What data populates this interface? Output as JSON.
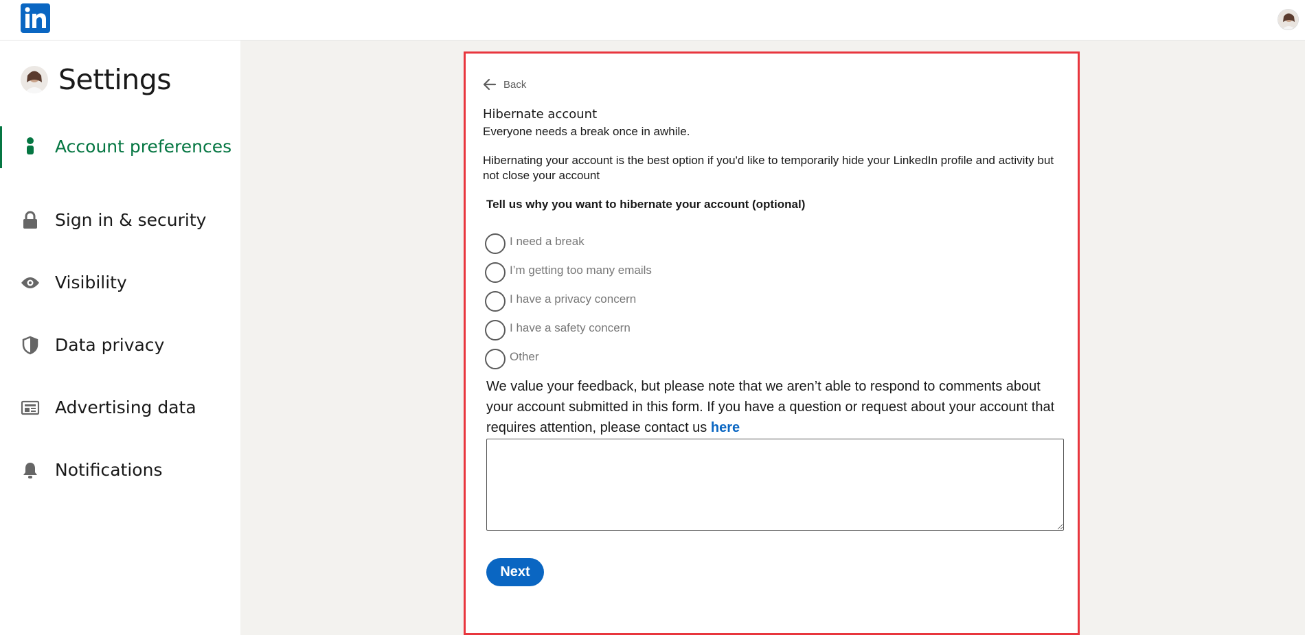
{
  "brand": {
    "logo_text": "in",
    "color": "#0a66c2"
  },
  "sidebar": {
    "title": "Settings",
    "items": [
      {
        "label": "Account preferences",
        "icon": "person-icon",
        "active": true
      },
      {
        "label": "Sign in & security",
        "icon": "lock-icon"
      },
      {
        "label": "Visibility",
        "icon": "eye-icon"
      },
      {
        "label": "Data privacy",
        "icon": "shield-icon"
      },
      {
        "label": "Advertising data",
        "icon": "newspaper-icon"
      },
      {
        "label": "Notifications",
        "icon": "bell-icon"
      }
    ]
  },
  "main": {
    "back_label": "Back",
    "title": "Hibernate account",
    "subtitle": "Everyone needs a break once in awhile.",
    "description": "Hibernating your account is the best option if you'd like to temporarily hide your LinkedIn profile and activity but not close your account",
    "question": "Tell us why you want to hibernate your account (optional)",
    "options": [
      "I need a break",
      "I’m getting too many emails",
      "I have a privacy concern",
      "I have a safety concern",
      "Other"
    ],
    "feedback_text": "We value your feedback, but please note that we aren’t able to respond to comments about your account submitted in this form. If you have a question or request about your account that requires attention, please contact us",
    "feedback_link": "here",
    "textarea_value": "",
    "next_label": "Next"
  },
  "colors": {
    "accent_green": "#057642",
    "highlight_border": "#e8363e",
    "button_blue": "#0a66c2"
  }
}
